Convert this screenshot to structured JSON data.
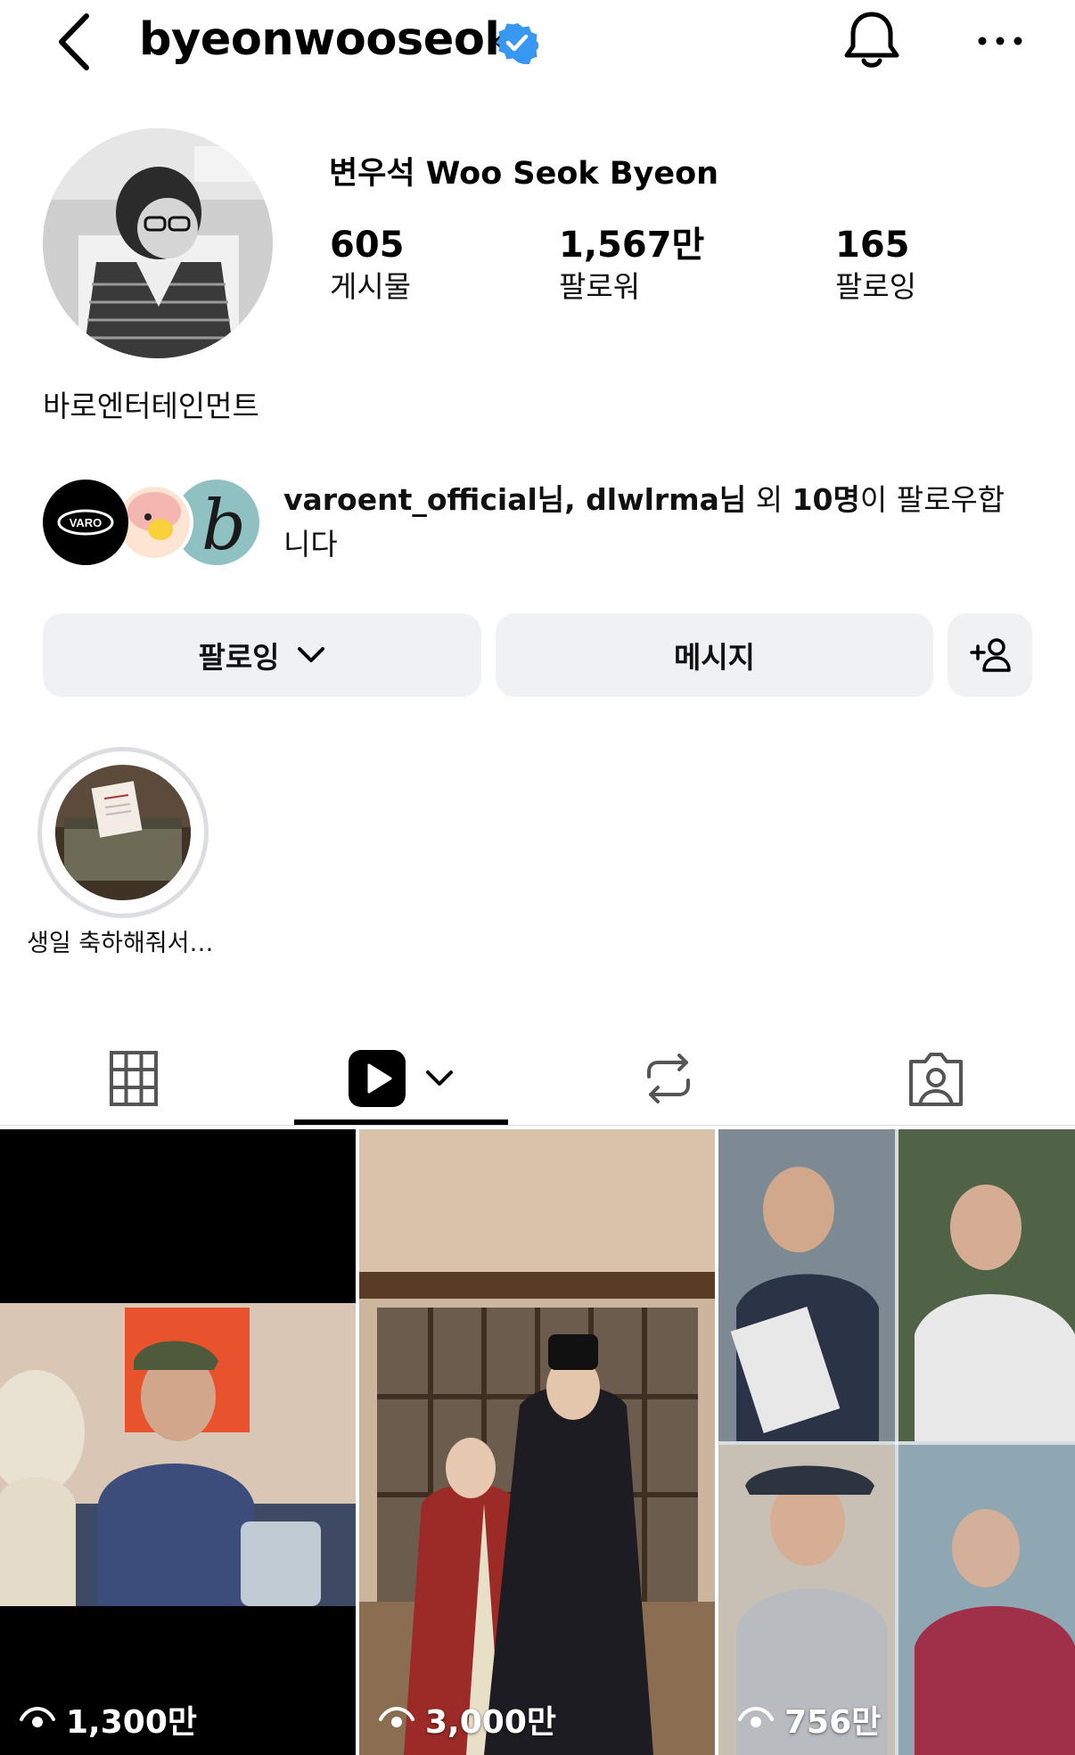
{
  "header": {
    "username": "byeonwooseok",
    "verified": true,
    "accent_color": "#3897f0"
  },
  "profile": {
    "display_name": "변우석  Woo Seok Byeon",
    "stats": [
      {
        "value": "605",
        "label": "게시물"
      },
      {
        "value": "1,567만",
        "label": "팔로워"
      },
      {
        "value": "165",
        "label": "팔로잉"
      }
    ],
    "category": "바로엔터테인먼트"
  },
  "mutual": {
    "names": "varoent_official님, dlwlrma님",
    "middle": " 외 ",
    "count": "10명",
    "suffix": "이 팔로우합니다",
    "avatar_logo_text": "VARO",
    "avatar_letter": "b"
  },
  "actions": {
    "following_label": "팔로잉",
    "message_label": "메시지",
    "add_user_icon": "add-person-icon"
  },
  "highlights": [
    {
      "label": "생일 축하해줘서…"
    }
  ],
  "tabs": [
    {
      "icon": "grid-icon",
      "active": false
    },
    {
      "icon": "reels-icon",
      "active": true
    },
    {
      "icon": "repost-icon",
      "active": false
    },
    {
      "icon": "tagged-icon",
      "active": false
    }
  ],
  "reels": [
    {
      "views": "1,300만"
    },
    {
      "views": "3,000만"
    },
    {
      "views": "756만"
    }
  ]
}
